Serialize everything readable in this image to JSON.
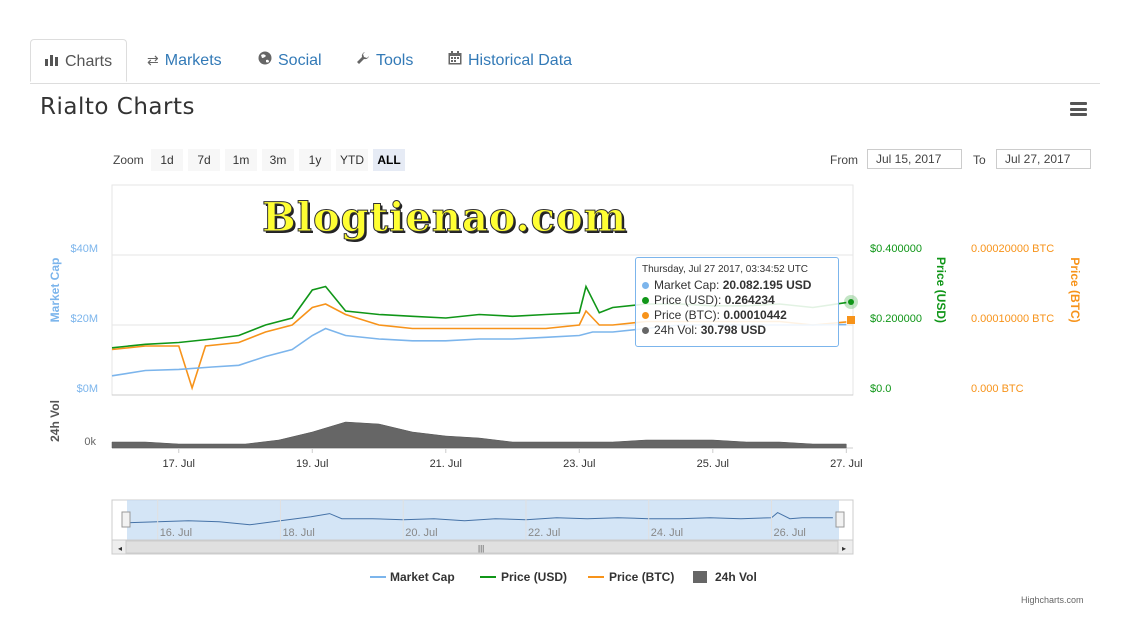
{
  "tabs": [
    {
      "label": "Charts",
      "icon": "bar-chart-icon"
    },
    {
      "label": "Markets",
      "icon": "exchange-icon"
    },
    {
      "label": "Social",
      "icon": "globe-icon"
    },
    {
      "label": "Tools",
      "icon": "wrench-icon"
    },
    {
      "label": "Historical Data",
      "icon": "calendar-icon"
    }
  ],
  "page_title": "Rialto Charts",
  "zoom": {
    "label": "Zoom",
    "buttons": [
      "1d",
      "7d",
      "1m",
      "3m",
      "1y",
      "YTD",
      "ALL"
    ],
    "active": "ALL"
  },
  "range": {
    "from_label": "From",
    "from": "Jul 15, 2017",
    "to_label": "To",
    "to": "Jul 27, 2017"
  },
  "watermark": "Blogtienao.com",
  "tooltip": {
    "header": "Thursday, Jul 27 2017, 03:34:52 UTC",
    "rows": [
      {
        "label": "Market Cap: ",
        "value": "20.082.195 USD",
        "color": "#7cb5ec"
      },
      {
        "label": "Price (USD): ",
        "value": "0.264234",
        "color": "#109618"
      },
      {
        "label": "Price (BTC): ",
        "value": "0.00010442",
        "color": "#f7931a"
      },
      {
        "label": "24h Vol: ",
        "value": "30.798 USD",
        "color": "#666666"
      }
    ]
  },
  "credits": "Highcharts.com",
  "chart_data": {
    "type": "line",
    "x_tick_labels": [
      "17. Jul",
      "19. Jul",
      "21. Jul",
      "23. Jul",
      "25. Jul",
      "27. Jul"
    ],
    "x_range_days": [
      16.0,
      27.1
    ],
    "axes": {
      "market_cap": {
        "title": "Market Cap",
        "ticks": [
          "$0M",
          "$20M",
          "$40M"
        ],
        "range": [
          0,
          40
        ],
        "color": "#7cb5ec"
      },
      "price_usd": {
        "title": "Price (USD)",
        "ticks": [
          "$0.0",
          "$0.200000",
          "$0.400000"
        ],
        "range": [
          0,
          0.4
        ],
        "color": "#109618"
      },
      "price_btc": {
        "title": "Price (BTC)",
        "ticks": [
          "0.000 BTC",
          "0.00010000 BTC",
          "0.00020000 BTC"
        ],
        "range": [
          0,
          0.0002
        ],
        "color": "#f7931a"
      },
      "volume": {
        "title": "24h Vol",
        "ticks": [
          "0k"
        ],
        "color": "#666666"
      }
    },
    "series": [
      {
        "name": "Market Cap",
        "axis": "market_cap",
        "color": "#7cb5ec",
        "points": [
          [
            16.0,
            5.5
          ],
          [
            16.5,
            7
          ],
          [
            17.0,
            7.3
          ],
          [
            17.5,
            8
          ],
          [
            17.9,
            8.5
          ],
          [
            18.3,
            11
          ],
          [
            18.7,
            13
          ],
          [
            19.0,
            17
          ],
          [
            19.2,
            19
          ],
          [
            19.5,
            17
          ],
          [
            20.0,
            16
          ],
          [
            20.5,
            15.5
          ],
          [
            21.0,
            15.5
          ],
          [
            21.5,
            16
          ],
          [
            22.0,
            16
          ],
          [
            22.5,
            16.5
          ],
          [
            23.0,
            17
          ],
          [
            23.2,
            18
          ],
          [
            23.5,
            18
          ],
          [
            24.0,
            19
          ],
          [
            24.5,
            20
          ],
          [
            25.0,
            20
          ],
          [
            25.5,
            20
          ],
          [
            26.0,
            20
          ],
          [
            26.5,
            20
          ],
          [
            27.0,
            20.1
          ]
        ]
      },
      {
        "name": "Price (USD)",
        "axis": "price_usd",
        "color": "#109618",
        "points": [
          [
            16.0,
            0.135
          ],
          [
            16.5,
            0.145
          ],
          [
            17.0,
            0.15
          ],
          [
            17.5,
            0.16
          ],
          [
            17.9,
            0.17
          ],
          [
            18.3,
            0.2
          ],
          [
            18.7,
            0.22
          ],
          [
            19.0,
            0.3
          ],
          [
            19.2,
            0.31
          ],
          [
            19.5,
            0.24
          ],
          [
            20.0,
            0.23
          ],
          [
            20.5,
            0.225
          ],
          [
            21.0,
            0.22
          ],
          [
            21.5,
            0.23
          ],
          [
            22.0,
            0.225
          ],
          [
            22.5,
            0.23
          ],
          [
            23.0,
            0.235
          ],
          [
            23.1,
            0.31
          ],
          [
            23.3,
            0.235
          ],
          [
            23.5,
            0.25
          ],
          [
            24.0,
            0.26
          ],
          [
            24.5,
            0.26
          ],
          [
            25.0,
            0.255
          ],
          [
            25.5,
            0.255
          ],
          [
            26.0,
            0.26
          ],
          [
            26.5,
            0.25
          ],
          [
            27.0,
            0.264
          ]
        ]
      },
      {
        "name": "Price (BTC)",
        "axis": "price_btc",
        "color": "#f7931a",
        "points": [
          [
            16.0,
            6.5e-05
          ],
          [
            16.5,
            7e-05
          ],
          [
            17.0,
            7e-05
          ],
          [
            17.2,
            1e-05
          ],
          [
            17.4,
            7e-05
          ],
          [
            17.9,
            7.5e-05
          ],
          [
            18.3,
            9e-05
          ],
          [
            18.7,
            0.0001
          ],
          [
            19.0,
            0.000125
          ],
          [
            19.2,
            0.00013
          ],
          [
            19.5,
            0.000115
          ],
          [
            20.0,
            0.0001
          ],
          [
            20.5,
            9.5e-05
          ],
          [
            21.0,
            9.5e-05
          ],
          [
            21.5,
            9.5e-05
          ],
          [
            22.0,
            9.5e-05
          ],
          [
            22.5,
            9.5e-05
          ],
          [
            23.0,
            0.0001
          ],
          [
            23.1,
            0.00012
          ],
          [
            23.3,
            0.0001
          ],
          [
            23.5,
            0.0001
          ],
          [
            24.0,
            0.000105
          ],
          [
            24.5,
            0.000105
          ],
          [
            25.0,
            0.000105
          ],
          [
            25.5,
            0.000105
          ],
          [
            26.0,
            0.000105
          ],
          [
            26.5,
            0.0001
          ],
          [
            27.0,
            0.00010442
          ]
        ]
      },
      {
        "name": "24h Vol",
        "axis": "volume",
        "color": "#666666",
        "type": "area",
        "points": [
          [
            16.0,
            0.15
          ],
          [
            16.5,
            0.15
          ],
          [
            17.0,
            0.1
          ],
          [
            17.5,
            0.1
          ],
          [
            18.0,
            0.1
          ],
          [
            18.5,
            0.2
          ],
          [
            19.0,
            0.4
          ],
          [
            19.5,
            0.65
          ],
          [
            20.0,
            0.6
          ],
          [
            20.5,
            0.4
          ],
          [
            21.0,
            0.3
          ],
          [
            21.5,
            0.25
          ],
          [
            22.0,
            0.15
          ],
          [
            22.5,
            0.15
          ],
          [
            23.0,
            0.15
          ],
          [
            23.5,
            0.15
          ],
          [
            24.0,
            0.2
          ],
          [
            24.5,
            0.2
          ],
          [
            25.0,
            0.2
          ],
          [
            25.5,
            0.15
          ],
          [
            26.0,
            0.15
          ],
          [
            26.5,
            0.1
          ],
          [
            27.0,
            0.1
          ]
        ]
      }
    ],
    "legend": [
      "Market Cap",
      "Price (USD)",
      "Price (BTC)",
      "24h Vol"
    ],
    "legend_position": "bottom-center",
    "navigator": {
      "tick_labels": [
        "16. Jul",
        "18. Jul",
        "20. Jul",
        "22. Jul",
        "24. Jul",
        "26. Jul"
      ],
      "range_days": [
        15.5,
        27.1
      ],
      "points": [
        [
          15.5,
          0.5
        ],
        [
          16.0,
          0.55
        ],
        [
          16.5,
          0.6
        ],
        [
          17.0,
          0.55
        ],
        [
          17.5,
          0.4
        ],
        [
          18.0,
          0.6
        ],
        [
          18.5,
          0.8
        ],
        [
          18.8,
          0.95
        ],
        [
          19.0,
          0.7
        ],
        [
          19.5,
          0.7
        ],
        [
          20.0,
          0.65
        ],
        [
          20.5,
          0.7
        ],
        [
          21.0,
          0.6
        ],
        [
          21.5,
          0.7
        ],
        [
          22.0,
          0.65
        ],
        [
          22.5,
          0.75
        ],
        [
          23.0,
          0.7
        ],
        [
          23.5,
          0.75
        ],
        [
          24.0,
          0.7
        ],
        [
          24.5,
          0.7
        ],
        [
          25.0,
          0.75
        ],
        [
          25.5,
          0.7
        ],
        [
          26.0,
          0.75
        ],
        [
          26.1,
          1.0
        ],
        [
          26.3,
          0.7
        ],
        [
          26.5,
          0.75
        ],
        [
          27.0,
          0.75
        ]
      ]
    }
  }
}
